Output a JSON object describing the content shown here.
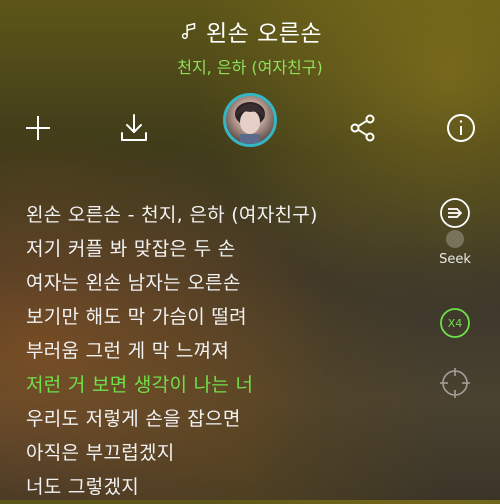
{
  "header": {
    "song_title": "왼손 오른손",
    "artist": "천지, 은하 (여자친구)"
  },
  "actions": {
    "add_icon": "plus-icon",
    "download_icon": "download-icon",
    "share_icon": "share-icon",
    "info_icon": "info-icon"
  },
  "lyrics": {
    "lines": [
      "왼손 오른손 - 천지, 은하 (여자친구)",
      "저기 커플 봐 맞잡은 두 손",
      "여자는 왼손 남자는 오른손",
      "보기만 해도 막 가슴이 떨려",
      "부러움 그런 게 막 느껴져",
      "저런 거 보면 생각이 나는 너",
      "우리도 저렇게 손을 잡으면",
      "아직은 부끄럽겠지",
      "너도 그렇겠지"
    ],
    "current_index": 5
  },
  "side": {
    "seek_label": "Seek",
    "speed_label": "X4"
  },
  "colors": {
    "accent_green": "#6fe04a",
    "avatar_ring": "#34b6c4"
  }
}
